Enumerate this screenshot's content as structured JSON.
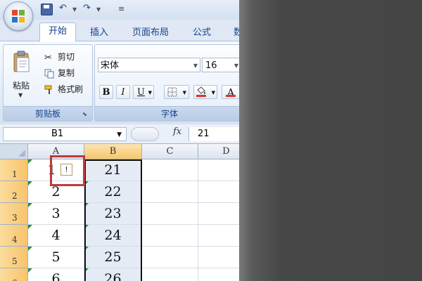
{
  "quick_access": {
    "save_icon": "save-icon",
    "undo_icon": "undo-icon",
    "redo_icon": "redo-icon",
    "customize_glyph": "≡"
  },
  "tabs": [
    {
      "label": "开始",
      "selected": true
    },
    {
      "label": "插入"
    },
    {
      "label": "页面布局"
    },
    {
      "label": "公式"
    },
    {
      "label": "数"
    }
  ],
  "clipboard": {
    "paste_label": "粘贴",
    "cut_label": "剪切",
    "copy_label": "复制",
    "format_painter_label": "格式刷",
    "group_label": "剪贴板"
  },
  "font": {
    "font_name": "宋体",
    "font_size": "16",
    "bold_label": "B",
    "italic_label": "I",
    "underline_label": "U",
    "font_color_label": "A",
    "group_label": "字体",
    "fill_color": "#e03030",
    "font_color": "#e03030"
  },
  "formula_bar": {
    "name_box": "B1",
    "fx_label": "fx",
    "formula_value": "21"
  },
  "sheet": {
    "columns": [
      "A",
      "B",
      "C",
      "D"
    ],
    "rows": [
      {
        "num": "1",
        "a": "1",
        "b": "21"
      },
      {
        "num": "2",
        "a": "2",
        "b": "22"
      },
      {
        "num": "3",
        "a": "3",
        "b": "23"
      },
      {
        "num": "4",
        "a": "4",
        "b": "24"
      },
      {
        "num": "5",
        "a": "5",
        "b": "25"
      },
      {
        "num": "6",
        "a": "6",
        "b": "26"
      }
    ],
    "warning_glyph": "!"
  },
  "colors": {
    "selection_border": "#111111",
    "highlight_box": "#c0393b",
    "header_selected": "#f8c76a"
  }
}
